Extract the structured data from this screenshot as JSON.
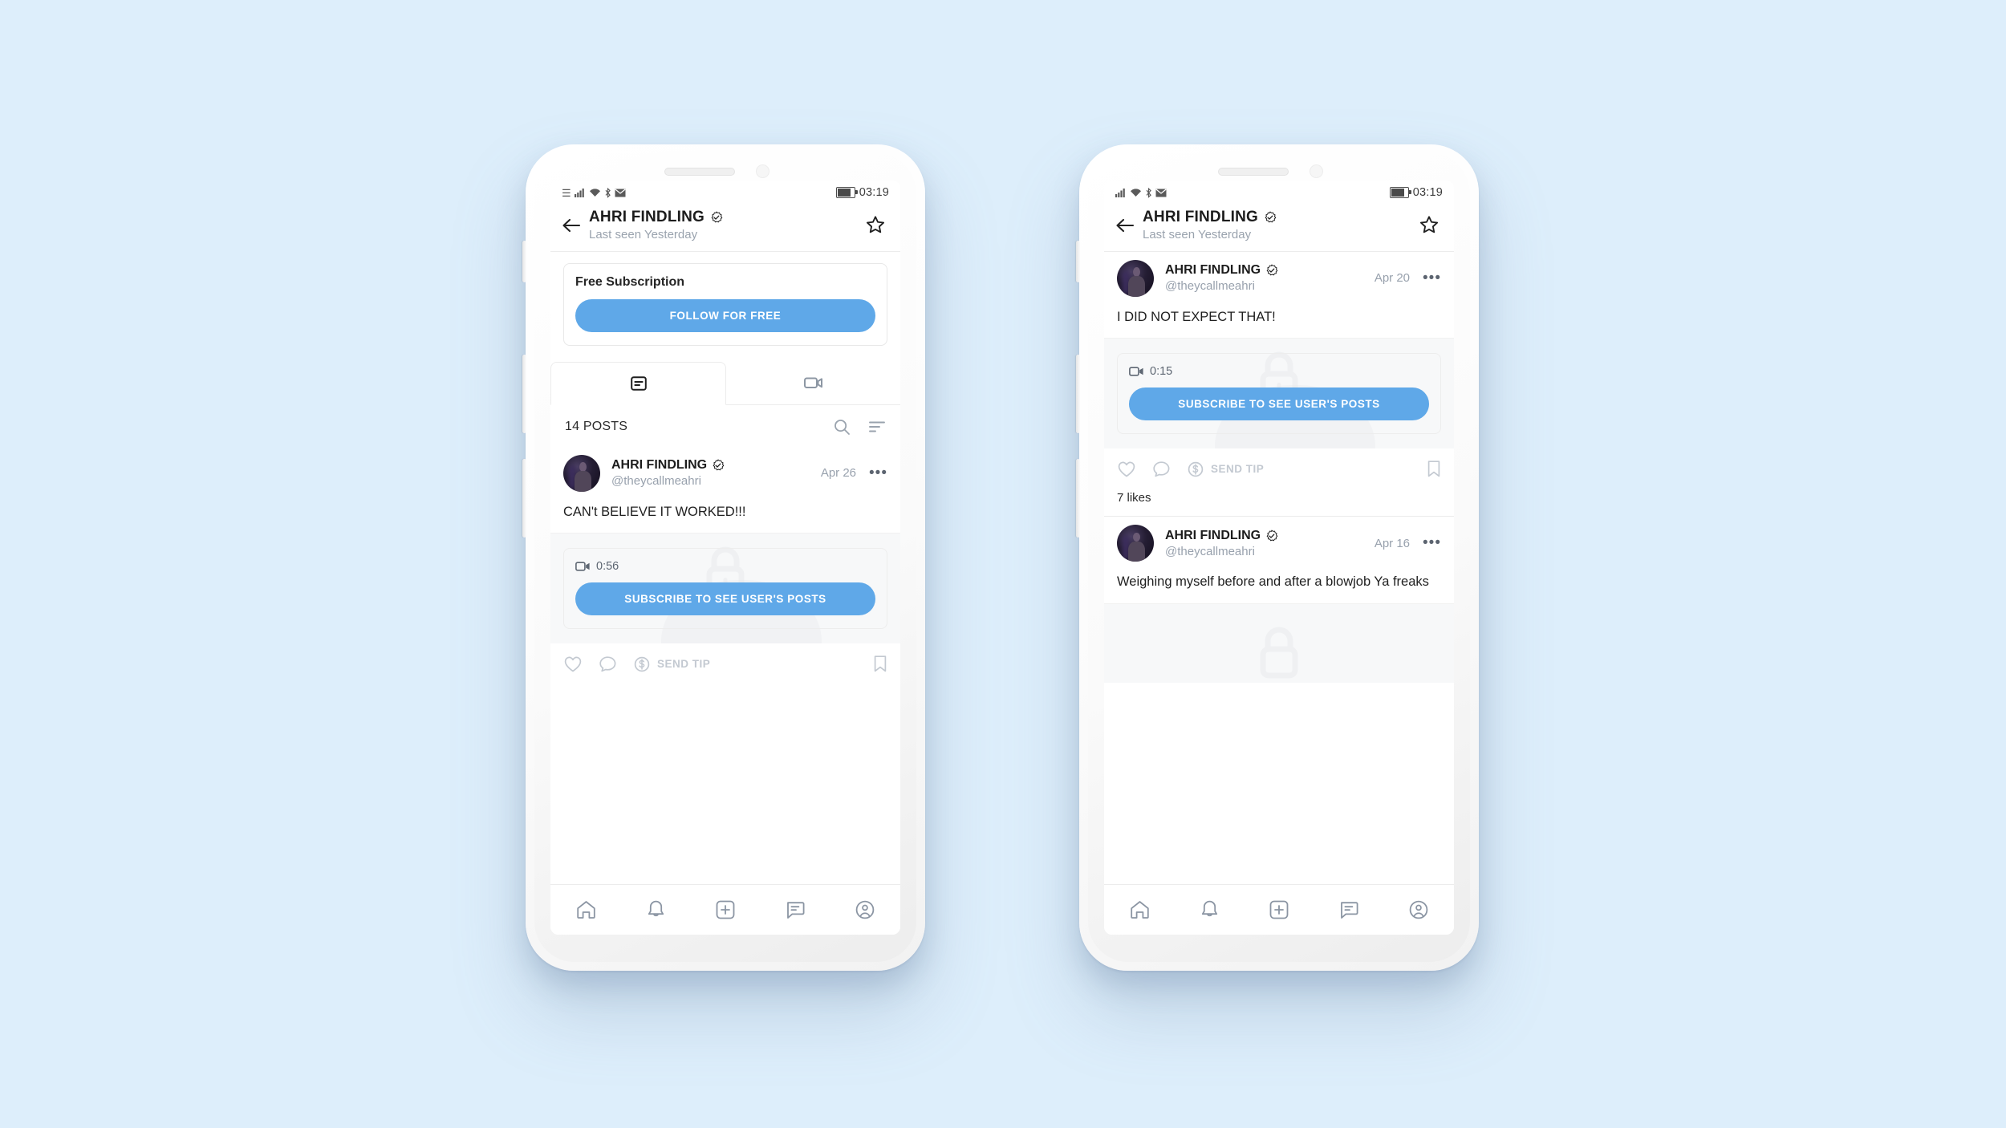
{
  "background_color": "#ddeefb",
  "accent_color": "#5fa8e8",
  "status_bar": {
    "time": "03:19",
    "icons": [
      "signal-icon",
      "wifi-icon",
      "bluetooth-icon",
      "mail-icon",
      "battery-icon"
    ]
  },
  "header": {
    "title": "AHRI FINDLING",
    "subtitle": "Last seen Yesterday",
    "back_icon": "arrow-left-icon",
    "favorite_icon": "star-icon",
    "verified_icon": "verified-badge-icon"
  },
  "subscription": {
    "title": "Free Subscription",
    "button_label": "FOLLOW FOR FREE"
  },
  "tabs": [
    {
      "id": "posts",
      "icon": "post-list-icon",
      "active": true
    },
    {
      "id": "videos",
      "icon": "video-camera-icon",
      "active": false
    }
  ],
  "posts_toolbar": {
    "count_label": "14 POSTS",
    "search_icon": "search-icon",
    "sort_icon": "sort-icon"
  },
  "locked_cta": "SUBSCRIBE TO SEE USER'S POSTS",
  "action_bar": {
    "like_icon": "heart-icon",
    "comment_icon": "comment-icon",
    "tip_icon": "dollar-circle-icon",
    "tip_label": "SEND TIP",
    "bookmark_icon": "bookmark-icon"
  },
  "bottom_nav": [
    {
      "id": "home",
      "icon": "home-icon"
    },
    {
      "id": "notifications",
      "icon": "bell-icon"
    },
    {
      "id": "create",
      "icon": "plus-square-icon"
    },
    {
      "id": "messages",
      "icon": "message-icon"
    },
    {
      "id": "profile",
      "icon": "profile-circle-icon"
    }
  ],
  "phone_left": {
    "posts": [
      {
        "author": "AHRI FINDLING",
        "handle": "@theycallmeahri",
        "date": "Apr 26",
        "text": "CAN't BELIEVE IT WORKED!!!",
        "duration": "0:56"
      }
    ]
  },
  "phone_right": {
    "posts": [
      {
        "author": "AHRI FINDLING",
        "handle": "@theycallmeahri",
        "date": "Apr 20",
        "text": "I DID NOT EXPECT THAT!",
        "duration": "0:15",
        "likes": "7 likes"
      },
      {
        "author": "AHRI FINDLING",
        "handle": "@theycallmeahri",
        "date": "Apr 16",
        "text": "Weighing myself before and after a blowjob Ya freaks"
      }
    ]
  }
}
